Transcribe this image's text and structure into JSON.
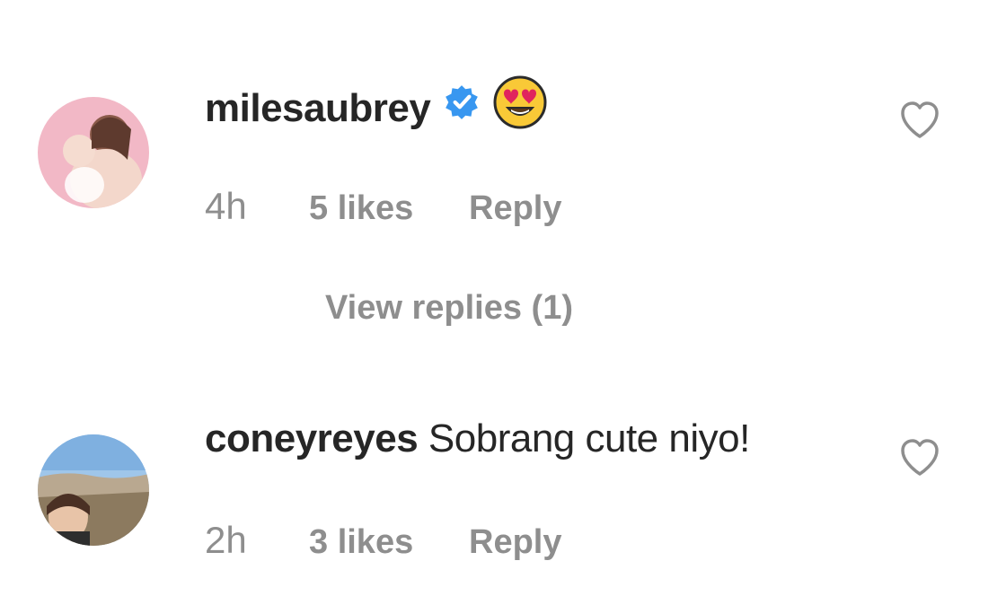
{
  "comments": [
    {
      "username": "milesaubrey",
      "text": "",
      "verified": true,
      "emoji": "heart-eyes-emoji",
      "time": "4h",
      "likes": "5 likes",
      "reply_label": "Reply",
      "view_replies": "View replies (1)"
    },
    {
      "username": "coneyreyes",
      "text": "Sobrang cute niyo!",
      "verified": false,
      "time": "2h",
      "likes": "3 likes",
      "reply_label": "Reply"
    }
  ],
  "colors": {
    "text": "#262626",
    "meta": "#8e8e8e",
    "verified": "#3897f0",
    "heart_outline": "#8e8e8e"
  }
}
